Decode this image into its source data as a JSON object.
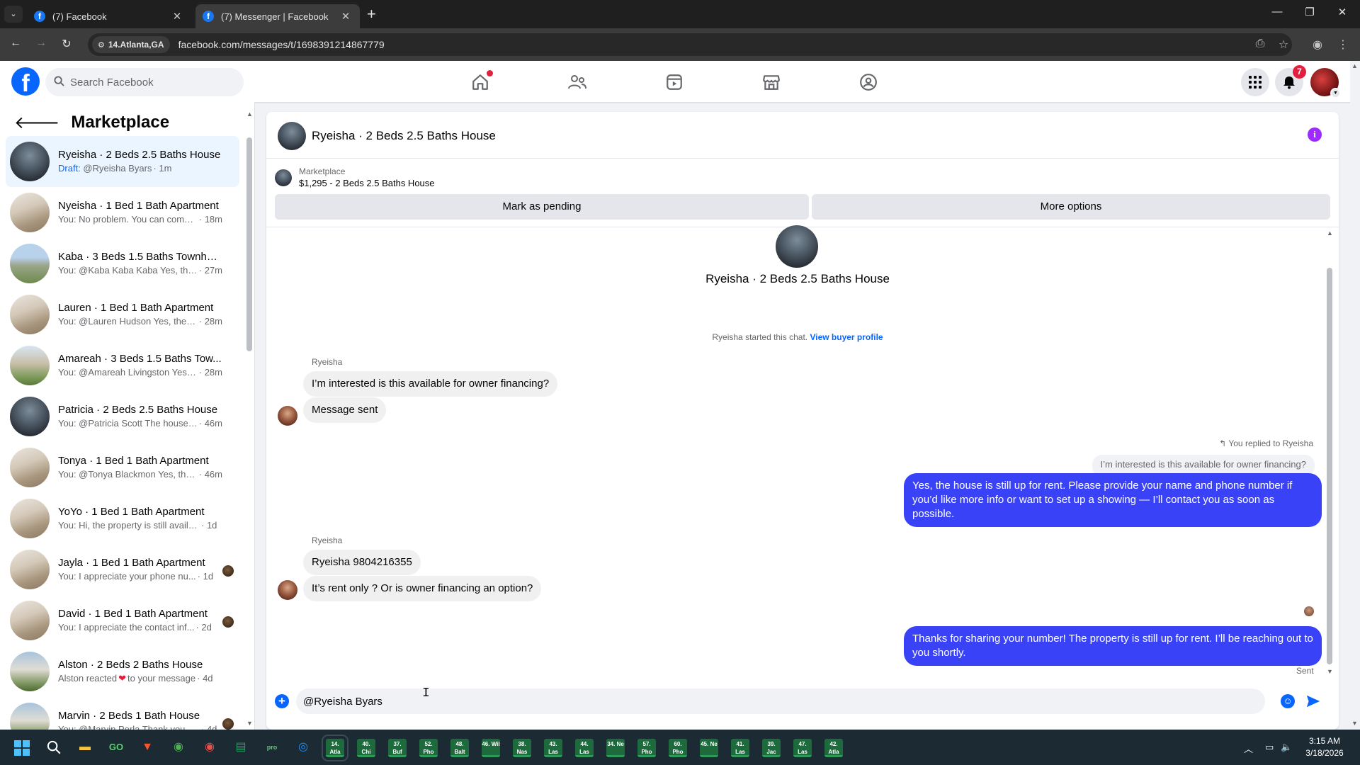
{
  "browser": {
    "tabs": [
      {
        "label": "(7) Facebook"
      },
      {
        "label": "(7) Messenger | Facebook"
      }
    ],
    "location_chip": "14.Atlanta,GA",
    "url": "facebook.com/messages/t/1698391214867779"
  },
  "fb": {
    "search_placeholder": "Search Facebook",
    "notifications_count": "7"
  },
  "sidebar": {
    "title": "Marketplace",
    "conversations": [
      {
        "name": "Ryeisha · 2 Beds 2.5 Baths House",
        "draft": "Draft:",
        "preview": "@Ryeisha Byars",
        "time": "· 1m",
        "active": true
      },
      {
        "name": "Nyeisha · 1 Bed 1 Bath Apartment",
        "preview": "You: No problem. You can come i...",
        "time": "· 18m"
      },
      {
        "name": "Kaba · 3 Beds 1.5 Baths Townhou...",
        "preview": "You: @Kaba Kaba Kaba Yes, the t...",
        "time": "· 27m"
      },
      {
        "name": "Lauren · 1 Bed 1 Bath Apartment",
        "preview": "You: @Lauren Hudson Yes, the ap...",
        "time": "· 28m"
      },
      {
        "name": "Amareah · 3 Beds 1.5 Baths Tow...",
        "preview": "You: @Amareah Livingston Yes, th...",
        "time": "· 28m"
      },
      {
        "name": "Patricia · 2 Beds 2.5 Baths House",
        "preview": "You: @Patricia Scott The house is ...",
        "time": "· 46m"
      },
      {
        "name": "Tonya · 1 Bed 1 Bath Apartment",
        "preview": "You: @Tonya Blackmon Yes, the a...",
        "time": "· 46m"
      },
      {
        "name": "YoYo · 1 Bed 1 Bath Apartment",
        "preview": "You: Hi, the property is still availabl...",
        "time": "· 1d"
      },
      {
        "name": "Jayla · 1 Bed 1 Bath Apartment",
        "preview": "You: I appreciate your phone nu...",
        "time": "· 1d"
      },
      {
        "name": "David · 1 Bed 1 Bath Apartment",
        "preview": "You: I appreciate the contact inf...",
        "time": "· 2d"
      },
      {
        "name": "Alston · 2 Beds 2 Baths House",
        "preview_a": "Alston reacted",
        "preview_b": "to your message",
        "time": "· 4d"
      },
      {
        "name": "Marvin · 2 Beds 1 Bath House",
        "preview": "You: @Marvin Perla Thank you. I...",
        "time": "· 4d"
      }
    ]
  },
  "chat": {
    "title": "Ryeisha · 2 Beds 2.5 Baths House",
    "listing_source": "Marketplace",
    "listing_title": "$1,295 - 2 Beds 2.5 Baths House",
    "mark_pending_label": "Mark as pending",
    "more_options_label": "More options",
    "hero_title": "Ryeisha · 2 Beds 2.5 Baths House",
    "started_text": "Ryeisha started this chat.",
    "view_profile_label": "View buyer profile",
    "messages": [
      {
        "sender": "Ryeisha",
        "text": "I’m interested is this available for owner financing?"
      },
      {
        "text": "Message sent"
      },
      {
        "replied_label": "You replied to Ryeisha",
        "quoted": "I’m interested is this available for owner financing?"
      },
      {
        "text": "Yes, the house is still up for rent. Please provide your name and phone number if you’d like more info or want to set up a showing — I’ll contact you as soon as possible."
      },
      {
        "sender": "Ryeisha",
        "text": "Ryeisha 9804216355"
      },
      {
        "text": "It’s rent only ? Or is owner financing an option?"
      },
      {
        "text": "Thanks for sharing your number! The property is still up for rent. I’ll be reaching out to you shortly."
      }
    ],
    "sent_label": "Sent",
    "composer_value": "@Ryeisha Byars"
  },
  "taskbar": {
    "apps": [
      "14. Atla",
      "40. Chi",
      "37. Buf",
      "52. Pho",
      "48. Balt",
      "46. Wil",
      "38. Nas",
      "43. Las",
      "44. Las",
      "34. Ne",
      "57. Pho",
      "60. Pho",
      "45. Ne",
      "41. Las",
      "39. Jac",
      "47. Las",
      "42. Atla"
    ],
    "time": "3:15 AM",
    "date": "3/18/2026"
  },
  "icons": {
    "facebook_logo": "f",
    "home": "home-icon",
    "friends": "friends-icon",
    "video": "video-icon",
    "marketplace": "marketplace-icon",
    "groups": "groups-icon"
  },
  "colors": {
    "fb_blue": "#0866ff",
    "outgoing_bubble": "#3a42f8",
    "incoming_bubble": "#f0f0f0",
    "active_conversation": "#ebf5ff",
    "badge_red": "#e41e3f"
  }
}
